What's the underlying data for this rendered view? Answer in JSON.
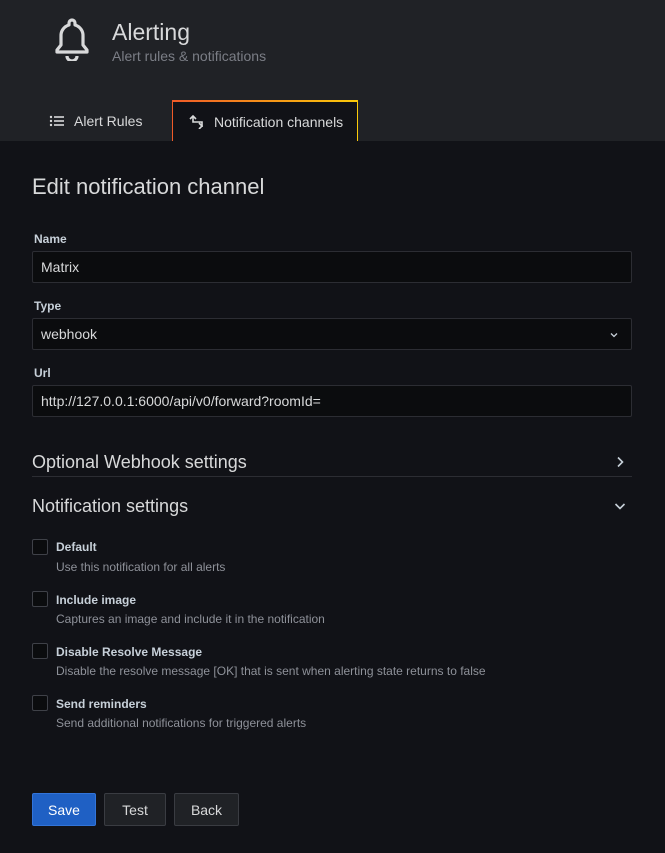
{
  "header": {
    "title": "Alerting",
    "subtitle": "Alert rules & notifications",
    "icon": "bell-icon"
  },
  "tabs": [
    {
      "label": "Alert Rules",
      "icon": "list-icon",
      "active": false
    },
    {
      "label": "Notification channels",
      "icon": "notification-channel-icon",
      "active": true
    }
  ],
  "page": {
    "title": "Edit notification channel"
  },
  "form": {
    "name": {
      "label": "Name",
      "value": "Matrix"
    },
    "type": {
      "label": "Type",
      "value": "webhook"
    },
    "url": {
      "label": "Url",
      "value": "http://127.0.0.1:6000/api/v0/forward?roomId="
    }
  },
  "sections": {
    "webhook": {
      "title": "Optional Webhook settings",
      "expanded": false
    },
    "notification": {
      "title": "Notification settings",
      "expanded": true
    }
  },
  "options": [
    {
      "label": "Default",
      "description": "Use this notification for all alerts",
      "checked": false
    },
    {
      "label": "Include image",
      "description": "Captures an image and include it in the notification",
      "checked": false
    },
    {
      "label": "Disable Resolve Message",
      "description": "Disable the resolve message [OK] that is sent when alerting state returns to false",
      "checked": false
    },
    {
      "label": "Send reminders",
      "description": "Send additional notifications for triggered alerts",
      "checked": false
    }
  ],
  "buttons": {
    "save": "Save",
    "test": "Test",
    "back": "Back"
  },
  "colors": {
    "background": "#111217",
    "header": "#202226",
    "primary": "#1f60c4",
    "tab_accent_start": "#f05a28",
    "tab_accent_end": "#fbca0a"
  }
}
